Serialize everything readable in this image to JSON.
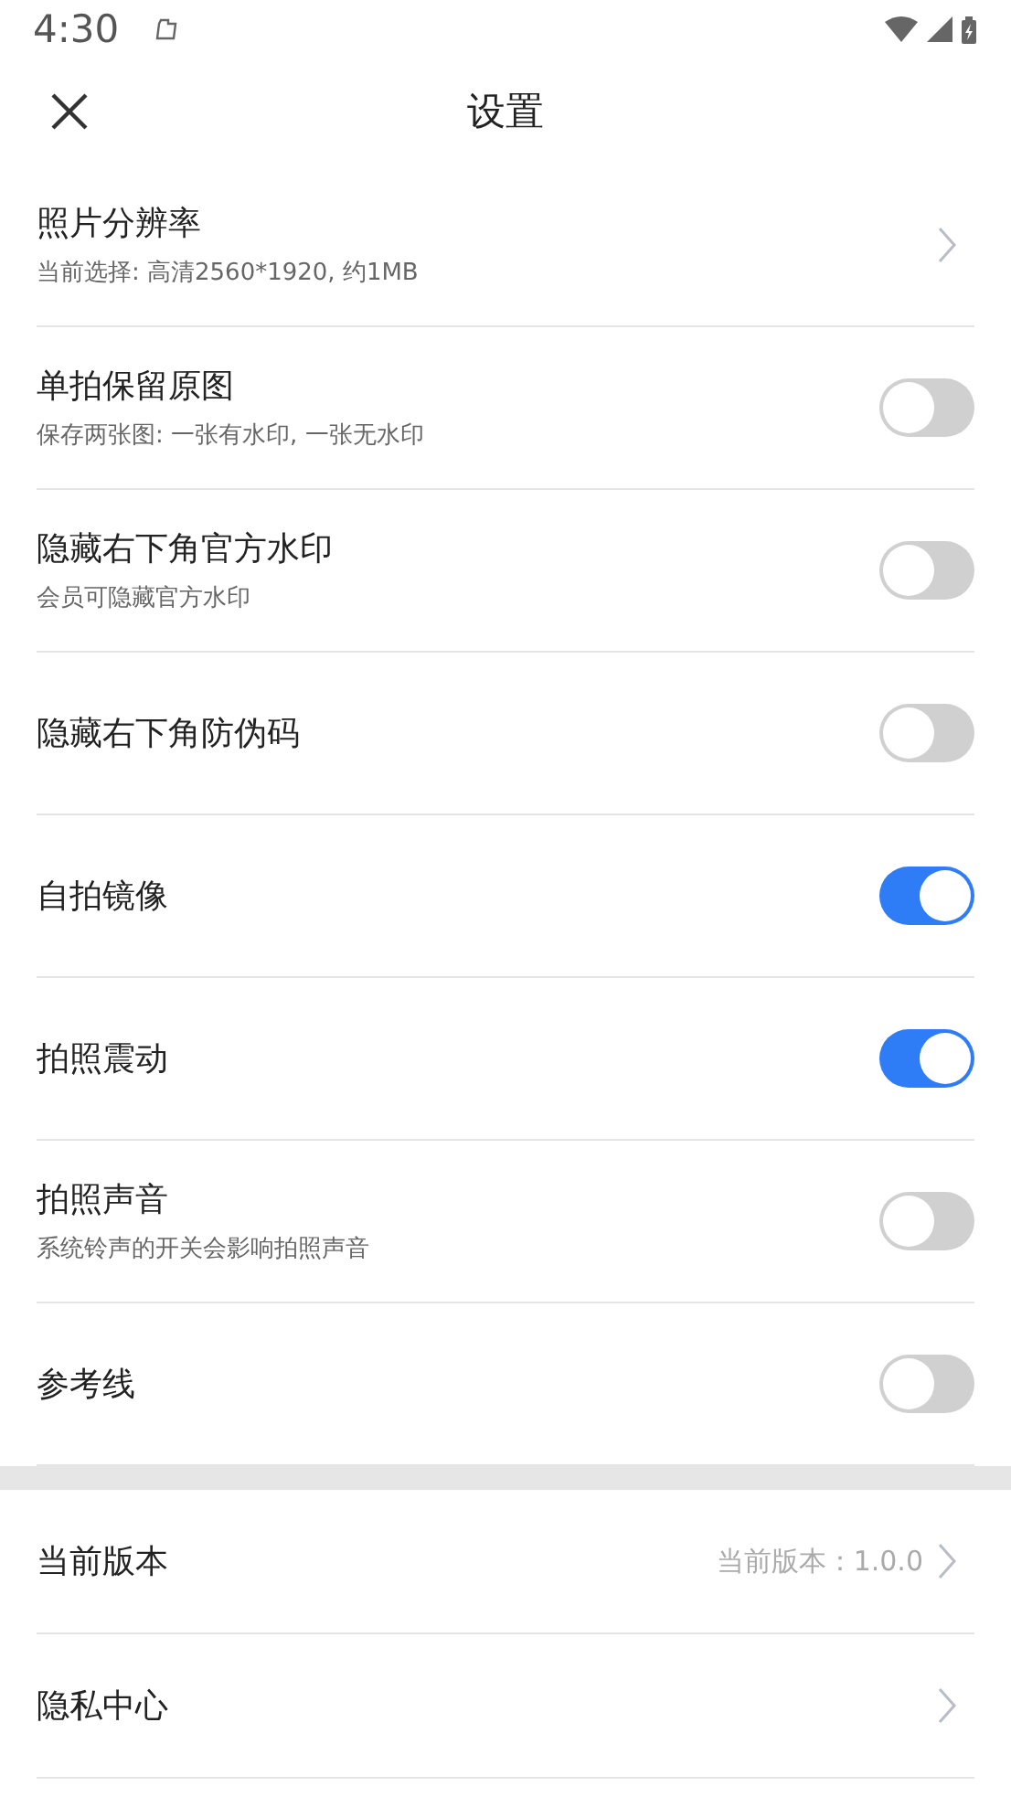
{
  "status_bar": {
    "time": "4:30"
  },
  "header": {
    "title": "设置"
  },
  "sections": [
    {
      "items": [
        {
          "kind": "nav",
          "label": "照片分辨率",
          "sub": "当前选择: 高清2560*1920, 约1MB"
        },
        {
          "kind": "toggle",
          "label": "单拍保留原图",
          "sub": "保存两张图: 一张有水印, 一张无水印",
          "on": false
        },
        {
          "kind": "toggle",
          "label": "隐藏右下角官方水印",
          "sub": "会员可隐藏官方水印",
          "on": false
        },
        {
          "kind": "toggle",
          "label": "隐藏右下角防伪码",
          "on": false
        },
        {
          "kind": "toggle",
          "label": "自拍镜像",
          "on": true
        },
        {
          "kind": "toggle",
          "label": "拍照震动",
          "on": true
        },
        {
          "kind": "toggle",
          "label": "拍照声音",
          "sub": "系统铃声的开关会影响拍照声音",
          "on": false
        },
        {
          "kind": "toggle",
          "label": "参考线",
          "on": false
        }
      ]
    },
    {
      "items": [
        {
          "kind": "nav",
          "label": "当前版本",
          "value": "当前版本：1.0.0"
        },
        {
          "kind": "nav",
          "label": "隐私中心"
        }
      ]
    }
  ]
}
